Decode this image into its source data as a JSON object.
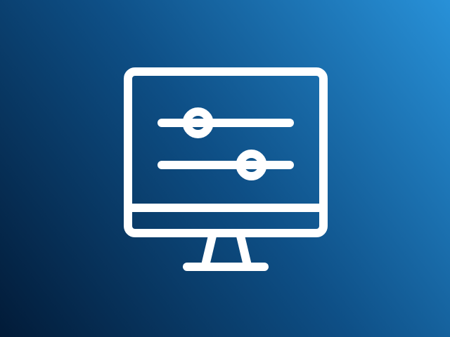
{
  "illustration": {
    "icon": "monitor-settings-sliders-icon",
    "colors": {
      "gradient_dark": "#021b38",
      "gradient_mid": "#0e4f86",
      "gradient_light": "#2891d8",
      "stroke": "#ffffff"
    },
    "sliders": [
      {
        "name": "top",
        "level": 0.2
      },
      {
        "name": "bottom",
        "level": 0.75
      }
    ]
  }
}
